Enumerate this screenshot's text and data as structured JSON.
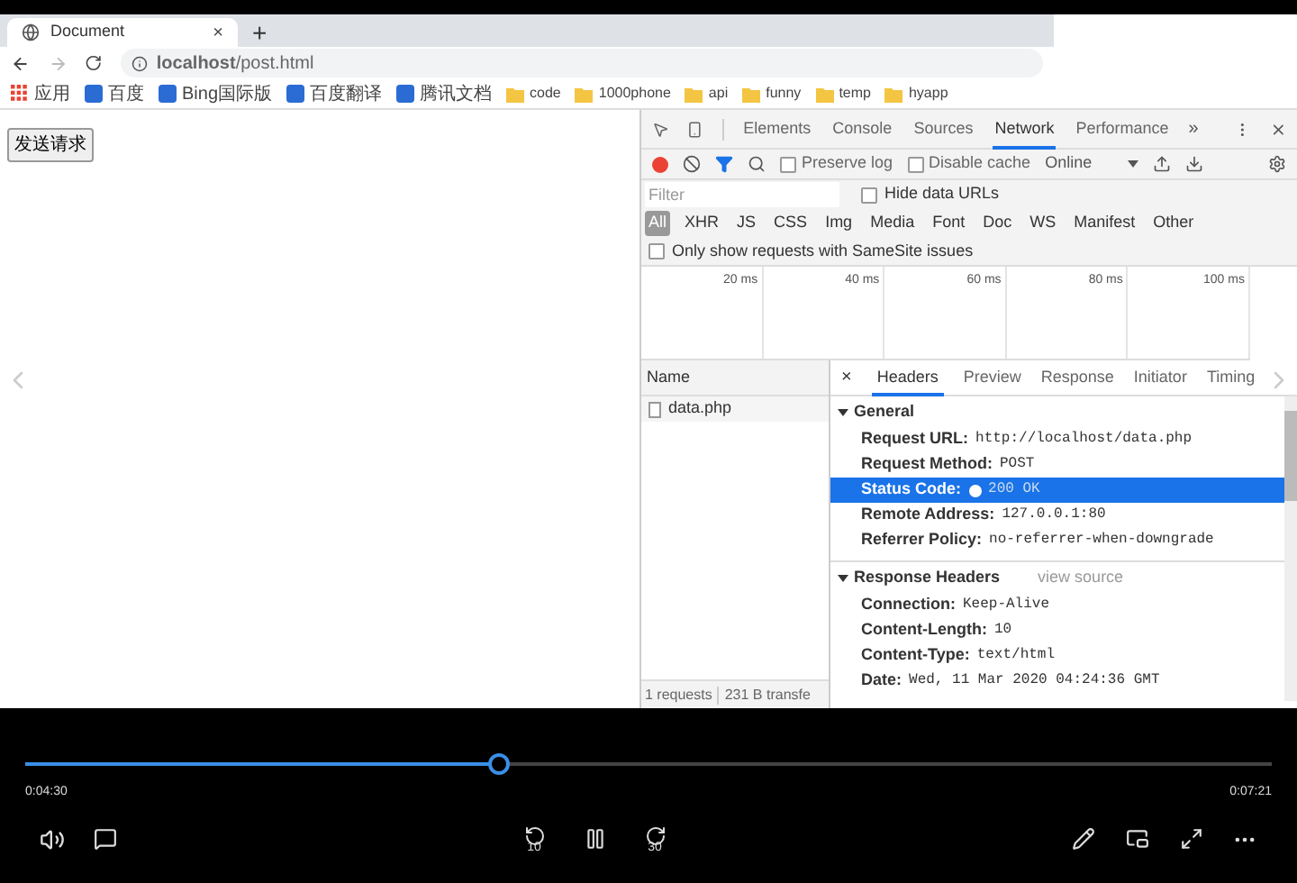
{
  "browser": {
    "tab_title": "Document",
    "tab_close": "×",
    "new_tab": "+",
    "url": "**localhost**/post.html",
    "bookmarks": [
      {
        "label": "应用",
        "kind": "apps"
      },
      {
        "label": "百度",
        "kind": "site"
      },
      {
        "label": "Bing国际版",
        "kind": "site"
      },
      {
        "label": "百度翻译",
        "kind": "site"
      },
      {
        "label": "腾讯文档",
        "kind": "site"
      },
      {
        "label": "code",
        "kind": "folder"
      },
      {
        "label": "1000phone",
        "kind": "folder"
      },
      {
        "label": "api",
        "kind": "folder"
      },
      {
        "label": "funny",
        "kind": "folder"
      },
      {
        "label": "temp",
        "kind": "folder"
      },
      {
        "label": "hyapp",
        "kind": "folder"
      }
    ]
  },
  "page": {
    "button": "发送请求"
  },
  "devtools": {
    "tabs": [
      {
        "label": "Elements",
        "selected": false
      },
      {
        "label": "Console",
        "selected": false
      },
      {
        "label": "Sources",
        "selected": false
      },
      {
        "label": "Network",
        "selected": true
      },
      {
        "label": "Performance",
        "selected": false
      }
    ],
    "more_tabs": "»",
    "recording": true,
    "options": [
      {
        "label": "Preserve log",
        "checked": false
      },
      {
        "label": "Disable cache",
        "checked": false
      }
    ],
    "throttle": "Online",
    "filter": {
      "placeholder": "Filter"
    },
    "hide_data_urls": {
      "label": "Hide data URLs",
      "checked": false
    },
    "types": [
      {
        "label": "All",
        "selected": true
      },
      {
        "label": "XHR",
        "selected": false
      },
      {
        "label": "JS",
        "selected": false
      },
      {
        "label": "CSS",
        "selected": false
      },
      {
        "label": "Img",
        "selected": false
      },
      {
        "label": "Media",
        "selected": false
      },
      {
        "label": "Font",
        "selected": false
      },
      {
        "label": "Doc",
        "selected": false
      },
      {
        "label": "WS",
        "selected": false
      },
      {
        "label": "Manifest",
        "selected": false
      },
      {
        "label": "Other",
        "selected": false
      }
    ],
    "samesite": {
      "label": "Only show requests with SameSite issues",
      "checked": false
    },
    "timeline_ticks": [
      "20 ms",
      "40 ms",
      "60 ms",
      "80 ms",
      "100 ms"
    ],
    "name_column": "Name",
    "requests": [
      {
        "name": "data.php",
        "selected": false
      }
    ],
    "detail_close": "×",
    "detail_tabs": [
      {
        "label": "Headers",
        "selected": true
      },
      {
        "label": "Preview",
        "selected": false
      },
      {
        "label": "Response",
        "selected": false
      },
      {
        "label": "Initiator",
        "selected": false
      },
      {
        "label": "Timing",
        "selected": false
      }
    ],
    "sections": [
      {
        "title": "General",
        "expanded": true,
        "rows": [
          {
            "key": "Request URL:",
            "value": "http://localhost/data.php",
            "selected": false
          },
          {
            "key": "Request Method:",
            "value": "POST",
            "selected": false
          },
          {
            "key": "Status Code:",
            "value": "200 OK",
            "selected": true,
            "status_dot": true
          },
          {
            "key": "Remote Address:",
            "value": "127.0.0.1:80",
            "selected": false
          },
          {
            "key": "Referrer Policy:",
            "value": "no-referrer-when-downgrade",
            "selected": false
          }
        ]
      },
      {
        "title": "Response Headers",
        "expanded": true,
        "link": "view source",
        "rows": [
          {
            "key": "Connection:",
            "value": "Keep-Alive",
            "selected": false
          },
          {
            "key": "Content-Length:",
            "value": "10",
            "selected": false
          },
          {
            "key": "Content-Type:",
            "value": "text/html",
            "selected": false
          },
          {
            "key": "Date:",
            "value": "Wed, 11 Mar 2020 04:24:36 GMT",
            "selected": false
          }
        ]
      }
    ],
    "status": [
      "1 requests",
      "231 B transfe"
    ]
  },
  "player": {
    "elapsed": "0:04:30",
    "total": "0:07:21",
    "level": 0.38,
    "playing": true,
    "rewind": "10",
    "forward": "30"
  }
}
